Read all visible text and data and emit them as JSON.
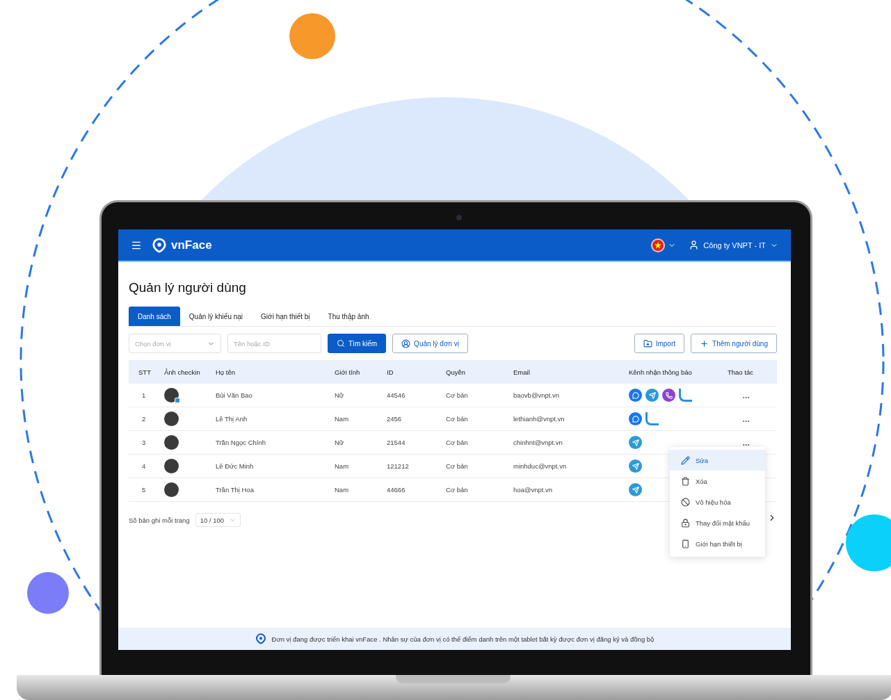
{
  "header": {
    "logo_text": "vnFace",
    "account": "Công ty VNPT - IT"
  },
  "page_title": "Quản lý người dùng",
  "tabs": [
    {
      "label": "Danh sách",
      "selected": true
    },
    {
      "label": "Quản lý khiếu nại",
      "selected": false
    },
    {
      "label": "Giới hạn thiết bị",
      "selected": false
    },
    {
      "label": "Thu thập ảnh",
      "selected": false
    }
  ],
  "filters": {
    "unit_select": {
      "placeholder": "Chọn đơn vị"
    },
    "search": {
      "placeholder": "Tên hoặc ID"
    },
    "search_button": "Tìm kiếm",
    "units_button": "Quản lý đơn vị",
    "import_button": "Import",
    "add_button": "Thêm người dùng"
  },
  "table": {
    "columns": [
      "STT",
      "Ảnh checkin",
      "Họ tên",
      "Giới tính",
      "ID",
      "Quyền",
      "Email",
      "Kênh nhận thông báo",
      "Thao tác"
    ],
    "rows": [
      {
        "no": "1",
        "badge": true,
        "name": "Bùi Văn Bao",
        "gender": "Nữ",
        "id": "44546",
        "role": "Cơ bản",
        "email": "baovb@vnpt.vn",
        "channels": [
          {
            "kind": "messenger"
          },
          {
            "kind": "telegram"
          },
          {
            "kind": "viber"
          },
          {
            "kind": "zalo"
          }
        ],
        "action": "•••"
      },
      {
        "no": "2",
        "badge": false,
        "name": "Lê Thị Anh",
        "gender": "Nam",
        "id": "2456",
        "role": "Cơ bản",
        "email": "lethianh@vnpt.vn",
        "channels": [
          {
            "kind": "messenger"
          },
          {
            "kind": "zalo"
          }
        ],
        "action": "•••"
      },
      {
        "no": "3",
        "badge": false,
        "name": "Trần Ngọc Chính",
        "gender": "Nữ",
        "id": "21544",
        "role": "Cơ bản",
        "email": "chinhnt@vnpt.vn",
        "channels": [
          {
            "kind": "telegram"
          }
        ],
        "action": "•••"
      },
      {
        "no": "4",
        "badge": false,
        "name": "Lê Đức Minh",
        "gender": "Nam",
        "id": "121212",
        "role": "Cơ bản",
        "email": "minhduc@vnpt.vn",
        "channels": [
          {
            "kind": "telegram"
          }
        ]
      },
      {
        "no": "5",
        "badge": false,
        "name": "Trần Thị Hoa",
        "gender": "Nam",
        "id": "44666",
        "role": "Cơ bản",
        "email": "hoa@vnpt.vn",
        "channels": [
          {
            "kind": "telegram"
          }
        ]
      }
    ]
  },
  "pagination": {
    "label": "Số bản ghi mỗi trang",
    "page_size": "10 / 100"
  },
  "context_menu": [
    {
      "kind": "edit",
      "label": "Sửa",
      "selected": true
    },
    {
      "kind": "delete",
      "label": "Xóa",
      "selected": false
    },
    {
      "kind": "disable",
      "label": "Vô hiệu hóa",
      "selected": false
    },
    {
      "kind": "password",
      "label": "Thay đổi mật khẩu",
      "selected": false
    },
    {
      "kind": "device",
      "label": "Giới hạn thiết bị",
      "selected": false
    }
  ],
  "footer_notice": "Đơn vị đang được triển khai vnFace . Nhân sự của đơn vị có thể điểm danh trên một tablet bất kỳ được đơn vị đăng ký và đồng bộ"
}
